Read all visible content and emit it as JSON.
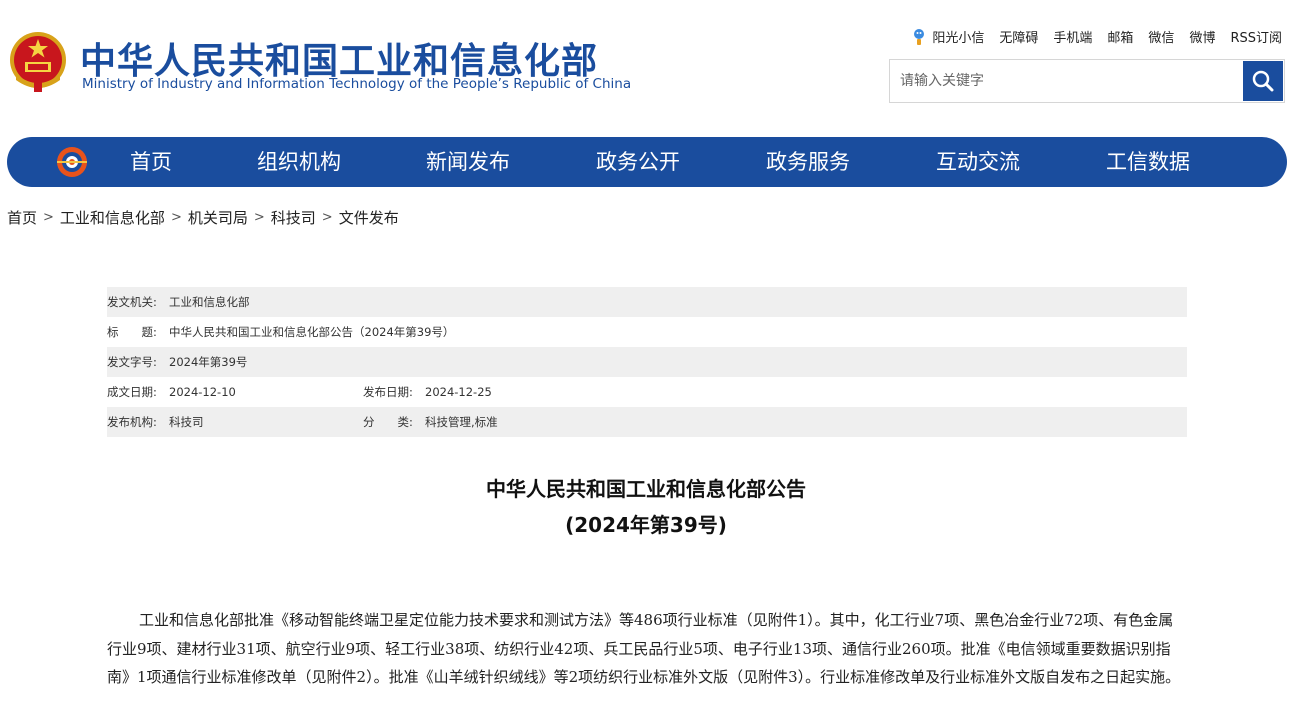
{
  "header": {
    "title": "中华人民共和国工业和信息化部",
    "subtitle": "Ministry of Industry and Information Technology of the People’s Republic of China",
    "top_links": [
      "阳光小信",
      "无障碍",
      "手机端",
      "邮箱",
      "微信",
      "微博",
      "RSS订阅"
    ],
    "search_placeholder": "请输入关键字"
  },
  "nav": {
    "items": [
      "首页",
      "组织机构",
      "新闻发布",
      "政务公开",
      "政务服务",
      "互动交流",
      "工信数据"
    ]
  },
  "breadcrumb": [
    "首页",
    "工业和信息化部",
    "机关司局",
    "科技司",
    "文件发布"
  ],
  "meta": {
    "issuer_label": "发文机关:",
    "issuer": "工业和信息化部",
    "title_label": "标　　题:",
    "title": "中华人民共和国工业和信息化部公告（2024年第39号）",
    "doc_no_label": "发文字号:",
    "doc_no": "2024年第39号",
    "date_label": "成文日期:",
    "date": "2024-12-10",
    "publish_label": "发布日期:",
    "publish": "2024-12-25",
    "org_label": "发布机构:",
    "org": "科技司",
    "category_label": "分　　类:",
    "category": "科技管理,标准"
  },
  "article": {
    "title_line1": "中华人民共和国工业和信息化部公告",
    "title_line2": "(2024年第39号)",
    "body": "工业和信息化部批准《移动智能终端卫星定位能力技术要求和测试方法》等486项行业标准（见附件1）。其中，化工行业7项、黑色冶金行业72项、有色金属行业9项、建材行业31项、航空行业9项、轻工行业38项、纺织行业42项、兵工民品行业5项、电子行业13项、通信行业260项。批准《电信领域重要数据识别指南》1项通信行业标准修改单（见附件2）。批准《山羊绒针织绒线》等2项纺织行业标准外文版（见附件3）。行业标准修改单及行业标准外文版自发布之日起实施。"
  },
  "colors": {
    "brand_blue": "#1a4d9e",
    "meta_shade": "#efefef"
  }
}
